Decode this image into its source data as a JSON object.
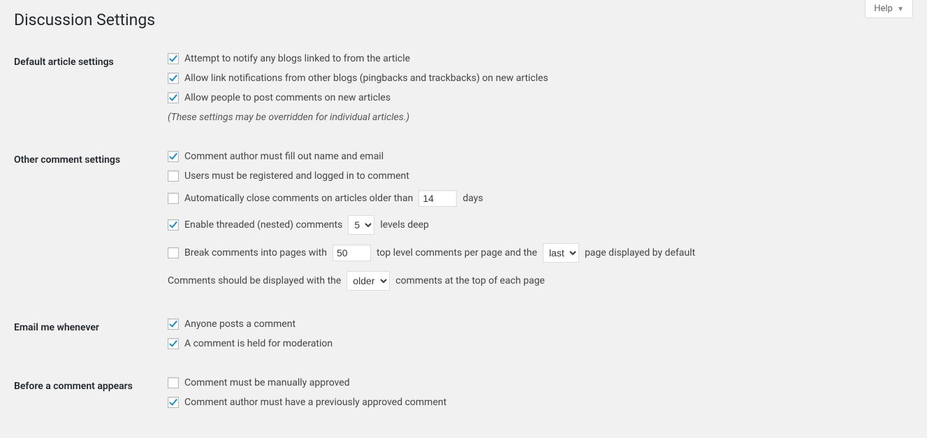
{
  "help": {
    "label": "Help"
  },
  "page": {
    "title": "Discussion Settings"
  },
  "sections": {
    "default_article": {
      "heading": "Default article settings",
      "notify_blogs": {
        "label": "Attempt to notify any blogs linked to from the article",
        "checked": true
      },
      "allow_pingbacks": {
        "label": "Allow link notifications from other blogs (pingbacks and trackbacks) on new articles",
        "checked": true
      },
      "allow_comments": {
        "label": "Allow people to post comments on new articles",
        "checked": true
      },
      "note": "(These settings may be overridden for individual articles.)"
    },
    "other_comment": {
      "heading": "Other comment settings",
      "require_name_email": {
        "label": "Comment author must fill out name and email",
        "checked": true
      },
      "require_registered": {
        "label": "Users must be registered and logged in to comment",
        "checked": false
      },
      "auto_close": {
        "checked": false,
        "label_before": "Automatically close comments on articles older than",
        "days_value": "14",
        "label_after": "days"
      },
      "threaded": {
        "checked": true,
        "label_before": "Enable threaded (nested) comments",
        "levels_value": "5",
        "label_after": "levels deep"
      },
      "paginate": {
        "checked": false,
        "label_before": "Break comments into pages with",
        "per_page_value": "50",
        "label_mid": "top level comments per page and the",
        "default_page_value": "last",
        "label_after": "page displayed by default"
      },
      "order": {
        "label_before": "Comments should be displayed with the",
        "order_value": "older",
        "label_after": "comments at the top of each page"
      }
    },
    "email_me": {
      "heading": "Email me whenever",
      "anyone_posts": {
        "label": "Anyone posts a comment",
        "checked": true
      },
      "held_moderation": {
        "label": "A comment is held for moderation",
        "checked": true
      }
    },
    "before_appears": {
      "heading": "Before a comment appears",
      "manual_approve": {
        "label": "Comment must be manually approved",
        "checked": false
      },
      "prev_approved": {
        "label": "Comment author must have a previously approved comment",
        "checked": true
      }
    }
  }
}
